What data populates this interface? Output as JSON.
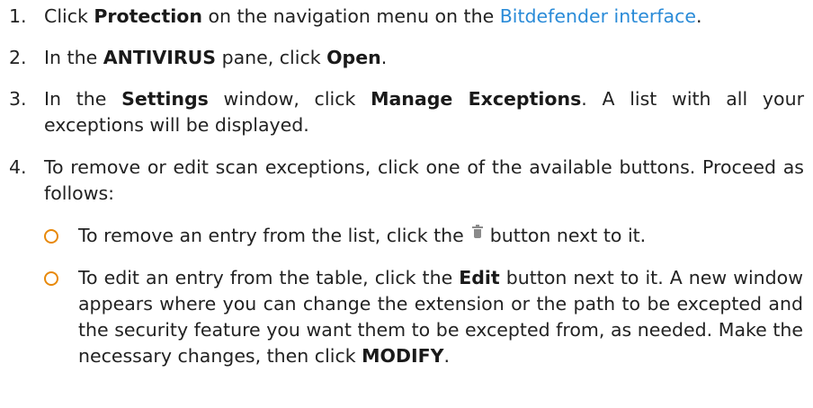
{
  "steps": [
    {
      "number": "1.",
      "t1": "Click ",
      "b1": "Protection",
      "t2": " on the navigation menu on the ",
      "link": "Bitdefender interface",
      "t3": "."
    },
    {
      "number": "2.",
      "t1": "In the ",
      "b1": "ANTIVIRUS",
      "t2": " pane, click ",
      "b2": "Open",
      "t3": "."
    },
    {
      "number": "3.",
      "t1": "In the ",
      "b1": "Settings",
      "t2": " window, click ",
      "b2": "Manage Exceptions",
      "t3": ". A list with all your exceptions will be displayed."
    },
    {
      "number": "4.",
      "t1": "To remove or edit scan exceptions, click one of the available buttons. Proceed as follows:"
    }
  ],
  "bullets": [
    {
      "t1": "To remove an entry from the list, click the ",
      "icon": "trash-icon",
      "t2": " button next to it."
    },
    {
      "t1": "To edit an entry from the table, click the ",
      "b1": "Edit",
      "t2": " button next to it. A new window appears where you can change the extension or the path to be excepted and the security feature you want them to be excepted from, as needed. Make the necessary changes, then click ",
      "b2": "MODIFY",
      "t3": "."
    }
  ],
  "colors": {
    "text": "#222222",
    "link": "#2a8bd8",
    "bullet_circle": "#e8890b"
  }
}
